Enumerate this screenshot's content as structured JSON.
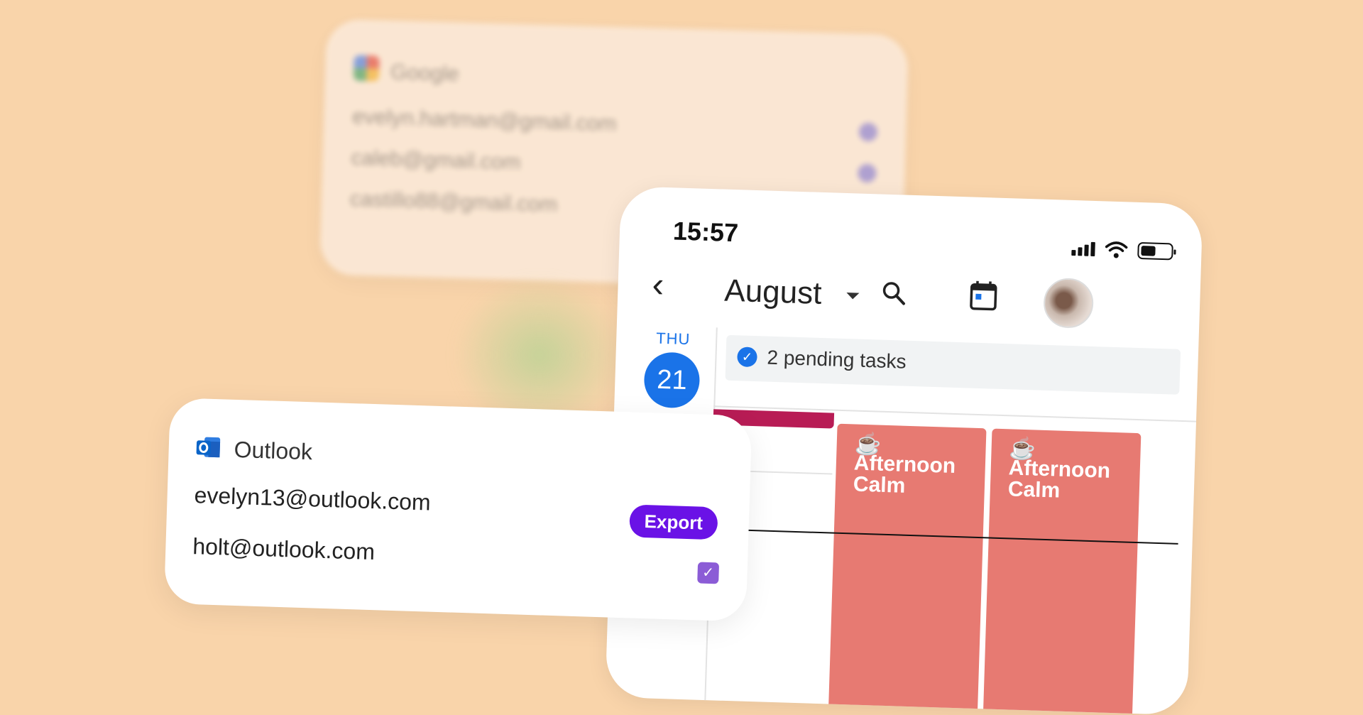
{
  "google_card": {
    "title": "Google",
    "emails": [
      "evelyn.hartman@gmail.com",
      "caleb@gmail.com",
      "castillo88@gmail.com"
    ]
  },
  "phone": {
    "status": {
      "time": "15:57"
    },
    "header": {
      "month": "August"
    },
    "day": {
      "name": "THU",
      "number": "21"
    },
    "pending_tasks": "2 pending tasks",
    "events": [
      {
        "emoji": "☕",
        "title": "Afternoon Calm"
      },
      {
        "emoji": "☕",
        "title": "Afternoon Calm"
      }
    ],
    "colors": {
      "accent": "#1a73e8",
      "event": "#e77a72",
      "bar": "#b81c55"
    }
  },
  "outlook_card": {
    "title": "Outlook",
    "accounts": [
      {
        "email": "evelyn13@outlook.com",
        "action": "Export"
      },
      {
        "email": "holt@outlook.com",
        "checked": true
      }
    ],
    "colors": {
      "export_bg": "#6a12e6",
      "checkbox": "#8b5cd6"
    }
  }
}
